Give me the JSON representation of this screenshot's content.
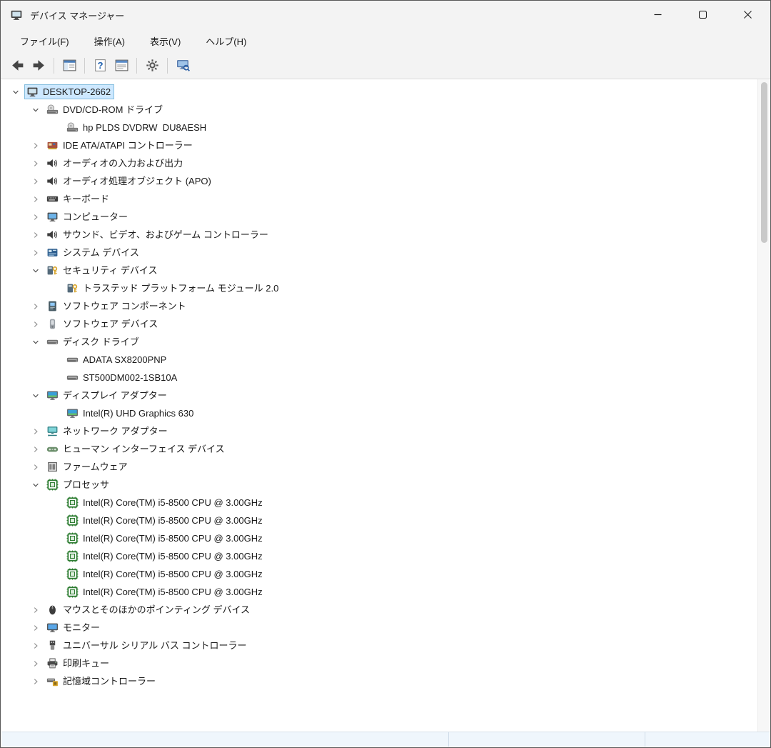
{
  "window": {
    "title": "デバイス マネージャー",
    "app_icon": "computer-icon"
  },
  "colors": {
    "chrome_bg": "#f3f3f3",
    "selection_bg": "#cde8ff",
    "selection_border": "#84bdde",
    "statusbar_bg": "#eff6fc"
  },
  "menubar": {
    "items": [
      {
        "label": "ファイル(F)"
      },
      {
        "label": "操作(A)"
      },
      {
        "label": "表示(V)"
      },
      {
        "label": "ヘルプ(H)"
      }
    ]
  },
  "toolbar": {
    "items": [
      {
        "type": "button",
        "name": "back",
        "icon": "arrow-left-icon"
      },
      {
        "type": "button",
        "name": "forward",
        "icon": "arrow-right-icon"
      },
      {
        "type": "separator"
      },
      {
        "type": "button",
        "name": "console-tree",
        "icon": "console-tree-icon"
      },
      {
        "type": "separator"
      },
      {
        "type": "button",
        "name": "help",
        "icon": "help-icon"
      },
      {
        "type": "button",
        "name": "properties",
        "icon": "properties-icon"
      },
      {
        "type": "separator"
      },
      {
        "type": "button",
        "name": "action",
        "icon": "gear-icon"
      },
      {
        "type": "separator"
      },
      {
        "type": "button",
        "name": "scan-hardware",
        "icon": "scan-hardware-icon"
      }
    ]
  },
  "tree": {
    "items": [
      {
        "level": 0,
        "state": "expanded",
        "icon": "computer-icon",
        "label": "DESKTOP-2662",
        "selected": true
      },
      {
        "level": 1,
        "state": "expanded",
        "icon": "dvd-drive-icon",
        "label": "DVD/CD-ROM ドライブ"
      },
      {
        "level": 2,
        "state": "leaf",
        "icon": "dvd-drive-icon",
        "label": "hp PLDS DVDRW  DU8AESH"
      },
      {
        "level": 1,
        "state": "collapsed",
        "icon": "ide-controller-icon",
        "label": "IDE ATA/ATAPI コントローラー"
      },
      {
        "level": 1,
        "state": "collapsed",
        "icon": "audio-endpoint-icon",
        "label": "オーディオの入力および出力"
      },
      {
        "level": 1,
        "state": "collapsed",
        "icon": "audio-apo-icon",
        "label": "オーディオ処理オブジェクト (APO)"
      },
      {
        "level": 1,
        "state": "collapsed",
        "icon": "keyboard-icon",
        "label": "キーボード"
      },
      {
        "level": 1,
        "state": "collapsed",
        "icon": "computer-device-icon",
        "label": "コンピューター"
      },
      {
        "level": 1,
        "state": "collapsed",
        "icon": "sound-icon",
        "label": "サウンド、ビデオ、およびゲーム コントローラー"
      },
      {
        "level": 1,
        "state": "collapsed",
        "icon": "system-device-icon",
        "label": "システム デバイス"
      },
      {
        "level": 1,
        "state": "expanded",
        "icon": "security-icon",
        "label": "セキュリティ デバイス"
      },
      {
        "level": 2,
        "state": "leaf",
        "icon": "security-icon",
        "label": "トラステッド プラットフォーム モジュール 2.0"
      },
      {
        "level": 1,
        "state": "collapsed",
        "icon": "software-component-icon",
        "label": "ソフトウェア コンポーネント"
      },
      {
        "level": 1,
        "state": "collapsed",
        "icon": "software-device-icon",
        "label": "ソフトウェア デバイス"
      },
      {
        "level": 1,
        "state": "expanded",
        "icon": "disk-drive-icon",
        "label": "ディスク ドライブ"
      },
      {
        "level": 2,
        "state": "leaf",
        "icon": "disk-drive-icon",
        "label": "ADATA SX8200PNP"
      },
      {
        "level": 2,
        "state": "leaf",
        "icon": "disk-drive-icon",
        "label": "ST500DM002-1SB10A"
      },
      {
        "level": 1,
        "state": "expanded",
        "icon": "display-adapter-icon",
        "label": "ディスプレイ アダプター"
      },
      {
        "level": 2,
        "state": "leaf",
        "icon": "display-adapter-icon",
        "label": "Intel(R) UHD Graphics 630"
      },
      {
        "level": 1,
        "state": "collapsed",
        "icon": "network-adapter-icon",
        "label": "ネットワーク アダプター"
      },
      {
        "level": 1,
        "state": "collapsed",
        "icon": "hid-icon",
        "label": "ヒューマン インターフェイス デバイス"
      },
      {
        "level": 1,
        "state": "collapsed",
        "icon": "firmware-icon",
        "label": "ファームウェア"
      },
      {
        "level": 1,
        "state": "expanded",
        "icon": "processor-icon",
        "label": "プロセッサ"
      },
      {
        "level": 2,
        "state": "leaf",
        "icon": "processor-icon",
        "label": "Intel(R) Core(TM) i5-8500 CPU @ 3.00GHz"
      },
      {
        "level": 2,
        "state": "leaf",
        "icon": "processor-icon",
        "label": "Intel(R) Core(TM) i5-8500 CPU @ 3.00GHz"
      },
      {
        "level": 2,
        "state": "leaf",
        "icon": "processor-icon",
        "label": "Intel(R) Core(TM) i5-8500 CPU @ 3.00GHz"
      },
      {
        "level": 2,
        "state": "leaf",
        "icon": "processor-icon",
        "label": "Intel(R) Core(TM) i5-8500 CPU @ 3.00GHz"
      },
      {
        "level": 2,
        "state": "leaf",
        "icon": "processor-icon",
        "label": "Intel(R) Core(TM) i5-8500 CPU @ 3.00GHz"
      },
      {
        "level": 2,
        "state": "leaf",
        "icon": "processor-icon",
        "label": "Intel(R) Core(TM) i5-8500 CPU @ 3.00GHz"
      },
      {
        "level": 1,
        "state": "collapsed",
        "icon": "mouse-icon",
        "label": "マウスとそのほかのポインティング デバイス"
      },
      {
        "level": 1,
        "state": "collapsed",
        "icon": "monitor-icon",
        "label": "モニター"
      },
      {
        "level": 1,
        "state": "collapsed",
        "icon": "usb-icon",
        "label": "ユニバーサル シリアル バス コントローラー"
      },
      {
        "level": 1,
        "state": "collapsed",
        "icon": "print-queue-icon",
        "label": "印刷キュー"
      },
      {
        "level": 1,
        "state": "collapsed",
        "icon": "storage-controller-icon",
        "label": "記憶域コントローラー"
      }
    ]
  },
  "statusbar": {
    "sections": [
      "",
      "",
      ""
    ]
  }
}
